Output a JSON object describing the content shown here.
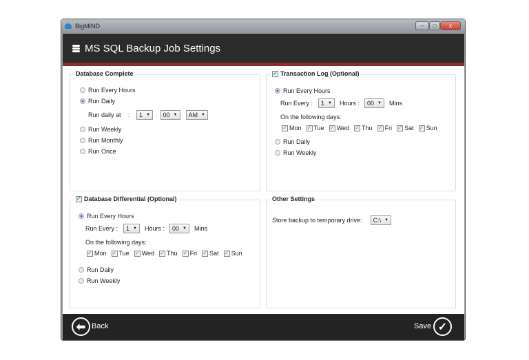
{
  "window": {
    "app_title": "BigMIND",
    "minimize": "–",
    "maximize": "□",
    "close": "x"
  },
  "header": {
    "title": "MS SQL Backup Job Settings",
    "icon": "database-icon"
  },
  "db_complete": {
    "title": "Database Complete",
    "options": [
      "Run Every Hours",
      "Run Daily",
      "Run Weekly",
      "Run Monthly",
      "Run Once"
    ],
    "selected": "Run Daily",
    "run_daily_at_label": "Run daily at",
    "sep": ":",
    "hour": "1",
    "minute": "00",
    "ampm": "AM"
  },
  "transaction_log": {
    "title": "Transaction Log (Optional)",
    "checked": true,
    "options": [
      "Run Every Hours",
      "Run Daily",
      "Run Weekly"
    ],
    "selected": "Run Every Hours",
    "run_every_label": "Run Every :",
    "hour": "1",
    "hours_label": "Hours :",
    "minute": "00",
    "mins_label": "Mins",
    "days_label": "On the following days:",
    "days": [
      "Mon",
      "Tue",
      "Wed",
      "Thu",
      "Fri",
      "Sat",
      "Sun"
    ]
  },
  "db_differential": {
    "title": "Database Differential (Optional)",
    "checked": true,
    "options": [
      "Run Every Hours",
      "Run Daily",
      "Run Weekly"
    ],
    "selected": "Run Every Hours",
    "run_every_label": "Run Every :",
    "hour": "1",
    "hours_label": "Hours :",
    "minute": "00",
    "mins_label": "Mins",
    "days_label": "On the following days:",
    "days": [
      "Mon",
      "Tue",
      "Wed",
      "Thu",
      "Fri",
      "Sat",
      "Sun"
    ]
  },
  "other": {
    "title": "Other Settings",
    "store_label": "Store backup to temporary drive:",
    "drive": "C:\\"
  },
  "footer": {
    "back": "Back",
    "save": "Save"
  }
}
